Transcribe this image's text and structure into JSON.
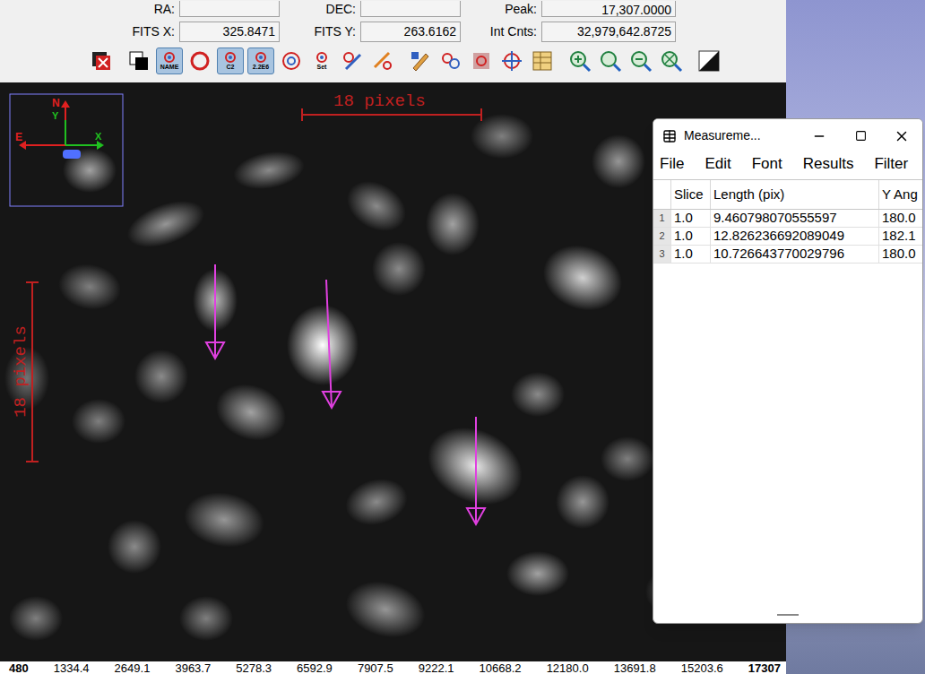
{
  "info": {
    "rows": [
      [
        {
          "label": "RA:",
          "value": ""
        },
        {
          "label": "DEC:",
          "value": ""
        },
        {
          "label": "Peak:",
          "value": "17,307.0000"
        }
      ],
      [
        {
          "label": "FITS X:",
          "value": "325.8471"
        },
        {
          "label": "FITS Y:",
          "value": "263.6162"
        },
        {
          "label": "Int Cnts:",
          "value": "32,979,642.8725"
        }
      ]
    ]
  },
  "toolbar": {
    "groups": [
      [
        {
          "kind": "clear",
          "label": "",
          "selected": false
        }
      ],
      [
        {
          "kind": "bw",
          "label": "",
          "selected": false
        },
        {
          "kind": "badge",
          "label": "NAME",
          "selected": true
        },
        {
          "kind": "ring",
          "label": "",
          "selected": false
        },
        {
          "kind": "badge",
          "label": "C2",
          "selected": true
        },
        {
          "kind": "badge",
          "label": "2.2E6",
          "selected": true
        },
        {
          "kind": "ring2",
          "label": "",
          "selected": false
        },
        {
          "kind": "badge",
          "label": "Set",
          "selected": false
        },
        {
          "kind": "pen",
          "label": "",
          "selected": false
        },
        {
          "kind": "brush",
          "label": "",
          "selected": false
        }
      ],
      [
        {
          "kind": "pencil",
          "label": "",
          "selected": false
        },
        {
          "kind": "circles",
          "label": "",
          "selected": false
        },
        {
          "kind": "crop",
          "label": "",
          "selected": false
        },
        {
          "kind": "target",
          "label": "",
          "selected": false
        },
        {
          "kind": "table",
          "label": "",
          "selected": false
        }
      ],
      [
        {
          "kind": "zoomin",
          "label": "",
          "selected": false
        },
        {
          "kind": "zoom",
          "label": "",
          "selected": false
        },
        {
          "kind": "zoomout",
          "label": "",
          "selected": false
        },
        {
          "kind": "zoomfit",
          "label": "",
          "selected": false
        }
      ],
      [
        {
          "kind": "contrast",
          "label": "",
          "selected": false
        }
      ]
    ]
  },
  "image": {
    "compass": {
      "north": "N",
      "y_axis": "Y",
      "east": "E",
      "x_axis": "X"
    },
    "scale_bars": [
      {
        "label": "18 pixels",
        "orientation": "horizontal"
      },
      {
        "label": "18 pixels",
        "orientation": "vertical"
      }
    ]
  },
  "colorbar": {
    "ticks": [
      "480",
      "1334.4",
      "2649.1",
      "3963.7",
      "5278.3",
      "6592.9",
      "7907.5",
      "9222.1",
      "10668.2",
      "12180.0",
      "13691.8",
      "15203.6",
      "17307"
    ]
  },
  "measurements": {
    "title": "Measureme...",
    "menu": [
      "File",
      "Edit",
      "Font",
      "Results",
      "Filter"
    ],
    "columns": [
      "",
      "Slice",
      "Length (pix)",
      "Y Ang"
    ],
    "rows": [
      [
        "1",
        "1.0",
        "9.460798070555597",
        "180.0"
      ],
      [
        "2",
        "1.0",
        "12.826236692089049",
        "182.1"
      ],
      [
        "3",
        "1.0",
        "10.726643770029796",
        "180.0"
      ]
    ]
  }
}
